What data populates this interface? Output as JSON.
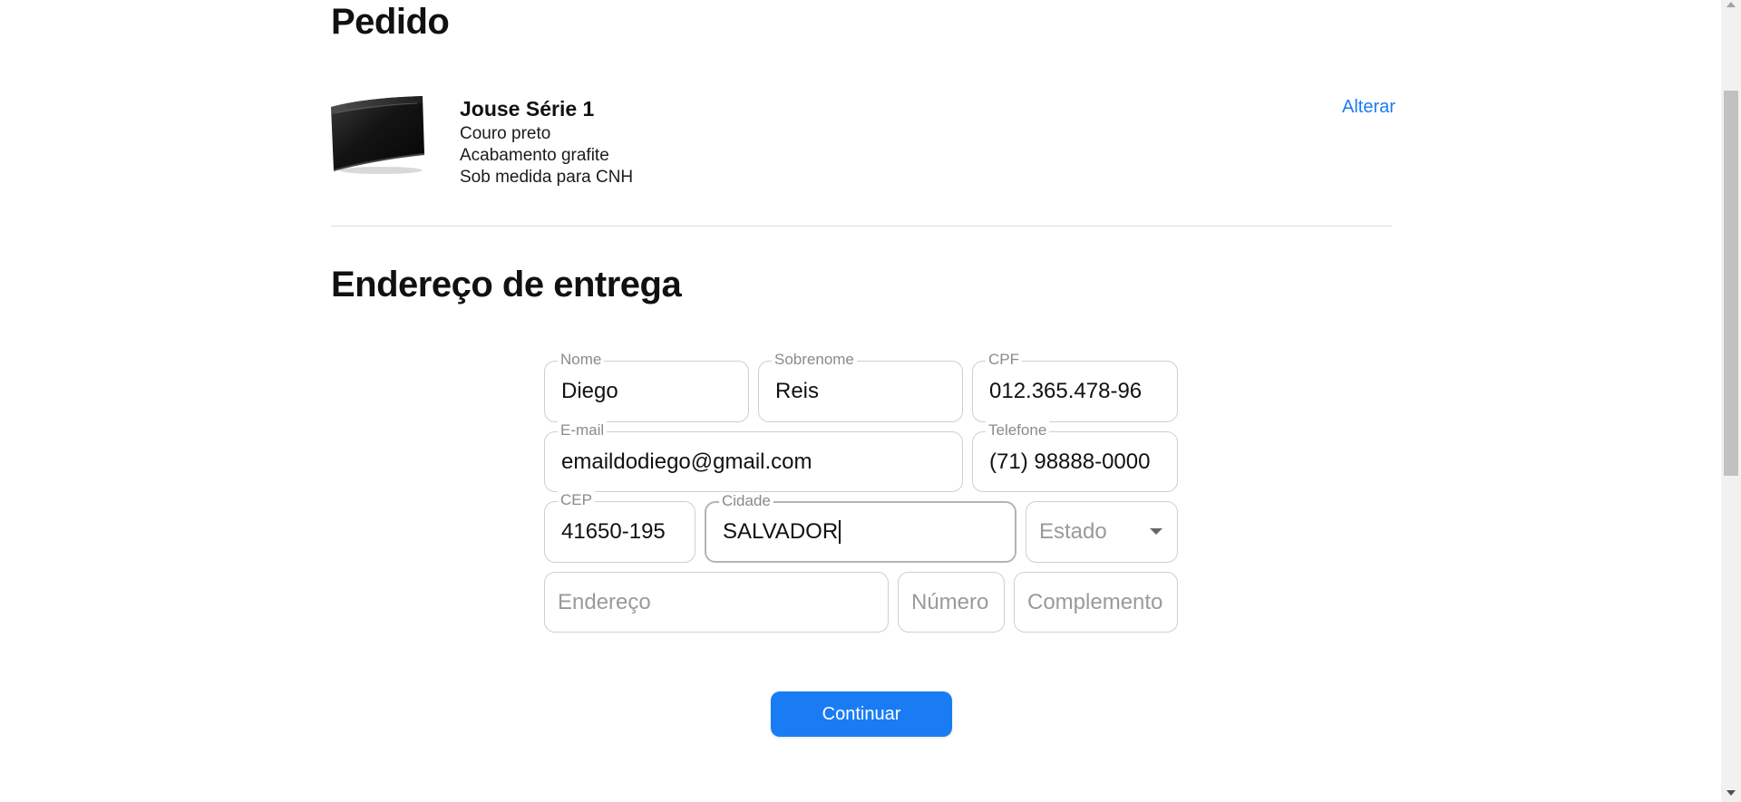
{
  "order": {
    "title": "Pedido",
    "product": {
      "image": "black-leather-wallet-image",
      "name": "Jouse Série 1",
      "lines": [
        "Couro preto",
        "Acabamento grafite",
        "Sob medida para CNH"
      ]
    },
    "change_link": "Alterar"
  },
  "shipping": {
    "title": "Endereço de entrega",
    "fields": {
      "nome": {
        "label": "Nome",
        "value": "Diego"
      },
      "sobrenome": {
        "label": "Sobrenome",
        "value": "Reis"
      },
      "cpf": {
        "label": "CPF",
        "value": "012.365.478-96"
      },
      "email": {
        "label": "E-mail",
        "value": "emaildodiego@gmail.com"
      },
      "telefone": {
        "label": "Telefone",
        "value": "(71) 98888-0000"
      },
      "cep": {
        "label": "CEP",
        "value": "41650-195"
      },
      "cidade": {
        "label": "Cidade",
        "value": "SALVADOR"
      },
      "estado": {
        "placeholder": "Estado"
      },
      "endereco": {
        "placeholder": "Endereço"
      },
      "numero": {
        "placeholder": "Número"
      },
      "complemento": {
        "placeholder": "Complemento"
      }
    },
    "submit_label": "Continuar"
  },
  "colors": {
    "accent": "#1a7cf4",
    "border": "#cfcfcf",
    "label": "#8a8a8a",
    "placeholder": "#9a9a9a"
  }
}
